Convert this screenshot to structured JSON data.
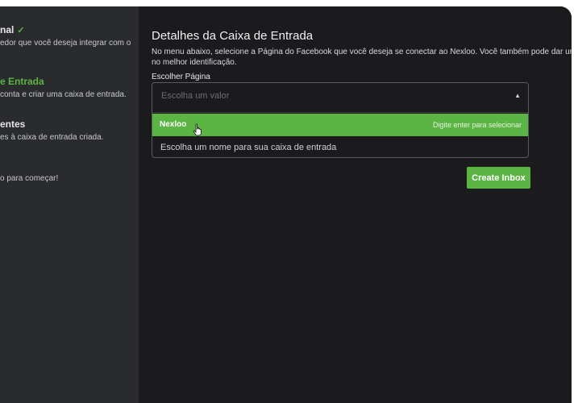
{
  "sidebar": {
    "steps": [
      {
        "title": "nal",
        "description": "edor que você deseja integrar com o",
        "completed": true
      },
      {
        "title": "e Entrada",
        "description": "conta e criar uma caixa de entrada.",
        "active": true
      },
      {
        "title": "entes",
        "description": "es à caixa de entrada criada."
      },
      {
        "title": "",
        "description": "o para começar!"
      }
    ]
  },
  "main": {
    "title": "Detalhes da Caixa de Entrada",
    "description": "No menu abaixo, selecione a Página do Facebook que você deseja se conectar ao Nexloo. Você também pode dar um no melhor identificação.",
    "page_label": "Escolher Página",
    "page_select": {
      "placeholder": "Escolha um valor",
      "option": "Nexloo",
      "hint": "Digite enter para selecionar"
    },
    "inbox_name_placeholder": "Escolha um nome para sua caixa de entrada",
    "create_button": "Create Inbox"
  },
  "colors": {
    "accent": "#5cb445",
    "background": "#1b1b1d",
    "sidebar": "#2a2b2d"
  },
  "icons": {
    "check": "check-icon",
    "caret": "caret-down-icon",
    "cursor": "hand-pointer-icon"
  }
}
